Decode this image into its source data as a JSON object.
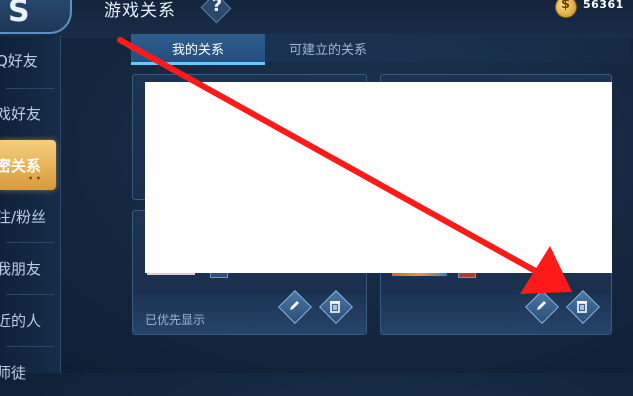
{
  "header": {
    "back_glyph": "S",
    "title": "游戏关系",
    "help": "?",
    "coin_sign": "$",
    "coin_count": "56361"
  },
  "sidebar": {
    "items": [
      {
        "label": "Q好友",
        "active": false
      },
      {
        "label": "戏好友",
        "active": false
      },
      {
        "label": "密关系",
        "active": true
      },
      {
        "label": "注/粉丝",
        "active": false
      },
      {
        "label": "我朋友",
        "active": false
      },
      {
        "label": "近的人",
        "active": false
      },
      {
        "label": "师徒",
        "active": false
      }
    ],
    "active_dots": "• •"
  },
  "tabs": {
    "mine": "我的关系",
    "available": "可建立的关系"
  },
  "cards": {
    "left_footer_text": "已优先显示"
  },
  "icons": {
    "edit": "pencil-icon",
    "delete": "trash-icon"
  },
  "colors": {
    "accent_gold": "#f6cf7c",
    "tab_active": "#2e5d8e",
    "annotation_arrow": "#ff1a1a"
  }
}
